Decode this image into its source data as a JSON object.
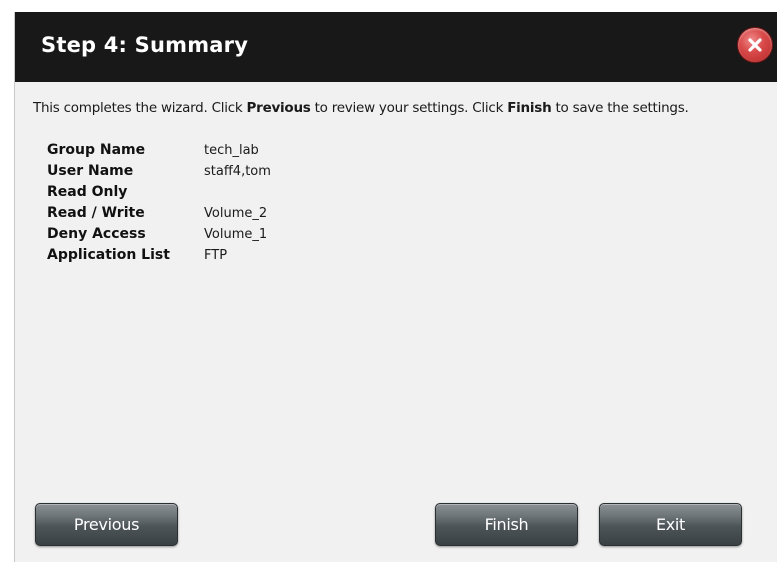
{
  "dialog": {
    "title": "Step 4: Summary",
    "intro": {
      "part1": "This completes the wizard. Click ",
      "previous_word": "Previous",
      "part2": " to review your settings. Click ",
      "finish_word": "Finish",
      "part3": " to save the settings."
    },
    "summary": [
      {
        "label": "Group Name",
        "value": "tech_lab"
      },
      {
        "label": "User Name",
        "value": "staff4,tom"
      },
      {
        "label": "Read Only",
        "value": ""
      },
      {
        "label": "Read / Write",
        "value": "Volume_2"
      },
      {
        "label": "Deny Access",
        "value": "Volume_1"
      },
      {
        "label": "Application List",
        "value": "FTP"
      }
    ],
    "buttons": {
      "previous": "Previous",
      "finish": "Finish",
      "exit": "Exit"
    }
  },
  "colors": {
    "titlebar": "#181818",
    "close_button": "#d94a4a",
    "button": "#4d5458"
  },
  "icons": {
    "close": "close-icon"
  }
}
